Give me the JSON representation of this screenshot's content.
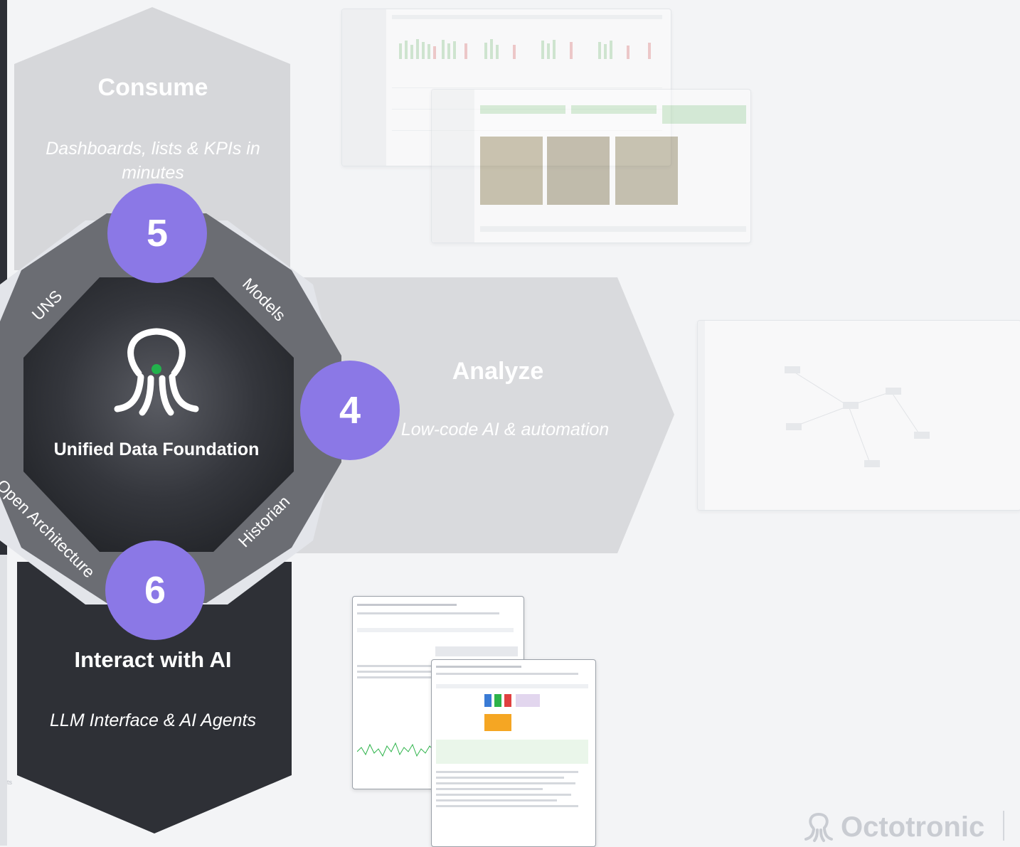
{
  "consume": {
    "title": "Consume",
    "subtitle": "Dashboards, lists & KPIs in minutes"
  },
  "analyze": {
    "title": "Analyze",
    "subtitle": "Low-code AI & automation"
  },
  "interact": {
    "title": "Interact with AI",
    "subtitle": "LLM Interface & AI Agents"
  },
  "steps": {
    "consume": "5",
    "analyze": "4",
    "interact": "6"
  },
  "foundation": {
    "title": "Unified Data Foundation",
    "ring_labels": {
      "uns": "UNS",
      "models": "Models",
      "historian": "Historian",
      "open_architecture": "Open Architecture"
    },
    "logo_icon": "octopus-icon"
  },
  "left_edge_text": "ts",
  "brand": {
    "name": "Octotronic",
    "icon": "octopus-icon"
  },
  "colors": {
    "accent_purple": "#8b78e6",
    "hex_gray": "#d6d7da",
    "hex_dark": "#2e3036",
    "ring_gray": "#6b6d73",
    "logo_green": "#22b24c"
  }
}
